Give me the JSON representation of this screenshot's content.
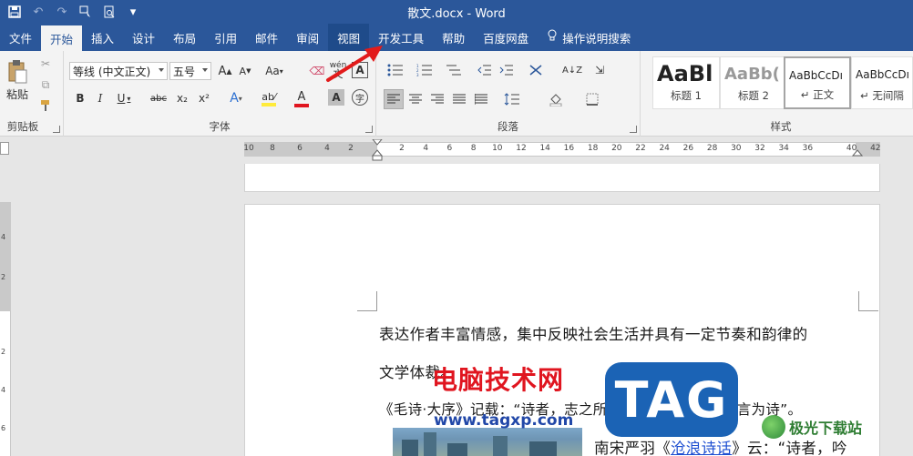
{
  "window": {
    "title": "散文.docx - Word"
  },
  "quick_access": {
    "items": [
      "save-icon",
      "undo-icon",
      "redo-icon",
      "touch-mode-icon",
      "print-preview-icon",
      "customize-icon"
    ]
  },
  "tabs": [
    {
      "label": "文件"
    },
    {
      "label": "开始"
    },
    {
      "label": "插入"
    },
    {
      "label": "设计"
    },
    {
      "label": "布局"
    },
    {
      "label": "引用"
    },
    {
      "label": "邮件"
    },
    {
      "label": "审阅"
    },
    {
      "label": "视图"
    },
    {
      "label": "开发工具"
    },
    {
      "label": "帮助"
    },
    {
      "label": "百度网盘"
    },
    {
      "label": "操作说明搜索"
    }
  ],
  "active_tab": "开始",
  "highlighted_tab": "视图",
  "ribbon": {
    "clipboard": {
      "label": "剪贴板",
      "paste_label": "粘贴"
    },
    "font": {
      "label": "字体",
      "font_name": "等线 (中文正文)",
      "font_size": "五号",
      "grow": "A",
      "shrink": "A",
      "case": "Aa",
      "phonetic": "wén",
      "border_char": "A",
      "bold": "B",
      "italic": "I",
      "underline": "U",
      "strike": "abc",
      "subscript": "x₂",
      "superscript": "x²",
      "effects": "A",
      "font_color": "A",
      "shade": "A",
      "enclose": "字"
    },
    "paragraph": {
      "label": "段落"
    },
    "styles": {
      "label": "样式",
      "items": [
        {
          "sample": "AaBl",
          "name": "标题 1"
        },
        {
          "sample": "AaBb(",
          "name": "标题 2"
        },
        {
          "sample": "AaBbCcDı",
          "name": "↵ 正文"
        },
        {
          "sample": "AaBbCcDı",
          "name": "↵ 无间隔"
        }
      ]
    }
  },
  "ruler": {
    "numbers": [
      "10",
      "8",
      "6",
      "4",
      "2",
      "2",
      "4",
      "6",
      "8",
      "10",
      "12",
      "14",
      "16",
      "18",
      "20",
      "22",
      "24",
      "26",
      "28",
      "30",
      "32",
      "34",
      "36",
      "40",
      "42"
    ]
  },
  "vruler": {
    "numbers": [
      "4",
      "2",
      "2",
      "4",
      "6"
    ]
  },
  "document": {
    "lines": [
      "表达作者丰富情感，集中反映社会生活并具有一定节奏和韵律的",
      "文学体裁。",
      "《毛诗·大序》记载：“诗者，志之所之也，在心为志，发言为诗”。"
    ],
    "line4_prefix": "南宋严羽《",
    "line4_link": "沧浪诗话",
    "line4_suffix": "》云：“诗者，吟"
  },
  "watermarks": {
    "cn_text": "电脑技术网",
    "url": "www.tagxp.com",
    "badge": "TAG",
    "site": "极光下载站"
  },
  "colors": {
    "title_bar": "#2b579a",
    "accent_red": "#e0151f",
    "link_blue": "#1e4fd1"
  }
}
